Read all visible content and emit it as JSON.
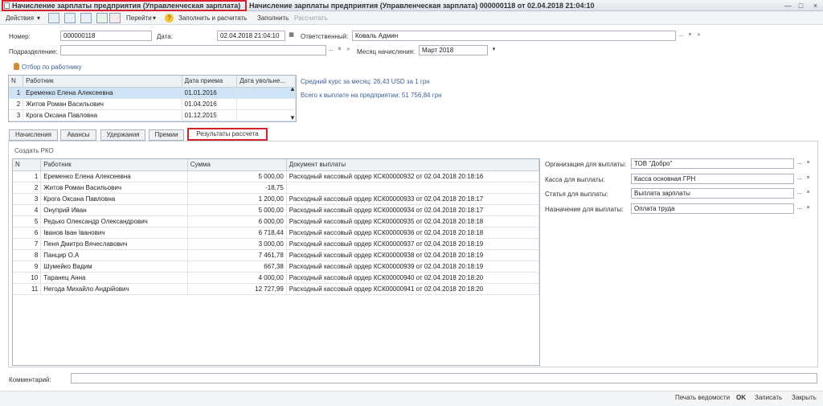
{
  "window": {
    "active_tab_title": "Начисление зарплаты предприятия (Управленческая зарплата)",
    "document_title": "Начисление зарплаты предприятия (Управленческая зарплата) 000000118 от 02.04.2018 21:04:10"
  },
  "toolbar": {
    "actions": "Действия",
    "go": "Перейти",
    "fill_and_calc": "Заполнить и расчитать",
    "fill": "Заполнить",
    "calc": "Рассчитать"
  },
  "header": {
    "number_label": "Номер:",
    "number_value": "000000118",
    "date_label": "Дата:",
    "date_value": "02.04.2018 21:04:10",
    "responsible_label": "Ответственный:",
    "responsible_value": "Коваль Админ",
    "department_label": "Подразделение:",
    "department_value": "",
    "month_label": "Месяц начисления:",
    "month_value": "Март 2018",
    "filter_label": "Отбор по работнику"
  },
  "employees_table": {
    "columns": [
      "N",
      "Работник",
      "Дата приема",
      "Дата увольне..."
    ],
    "rows": [
      [
        "1",
        "Еременко Елена Алексеевна",
        "01.01.2016",
        ""
      ],
      [
        "2",
        "Житов Роман Васильович",
        "01.04.2016",
        ""
      ],
      [
        "3",
        "Крога Оксана Павловна",
        "01.12.2015",
        ""
      ]
    ]
  },
  "info": {
    "rate": "Средний курс за месяц: 26,43 USD за 1 грн",
    "total": "Всего к выплате на предприятии: 51 756,84 грн"
  },
  "tabs": [
    "Начисления",
    "Авансы",
    "Удержания",
    "Премии",
    "Результаты рассчета"
  ],
  "results": {
    "create_rko": "Создать РКО",
    "columns": [
      "N",
      "Работник",
      "Сумма",
      "Документ выплаты"
    ],
    "rows": [
      [
        "1",
        "Еременко Елена Алексеевна",
        "5 000,00",
        "Расходный кассовый ордер КСК00000932 от 02.04.2018 20:18:16"
      ],
      [
        "2",
        "Житов Роман Васильович",
        "-18,75",
        ""
      ],
      [
        "3",
        "Крога Оксана Павловна",
        "1 200,00",
        "Расходный кассовый ордер КСК00000933 от 02.04.2018 20:18:17"
      ],
      [
        "4",
        "Онуприй Иван",
        "5 000,00",
        "Расходный кассовый ордер КСК00000934 от 02.04.2018 20:18:17"
      ],
      [
        "5",
        "Редько Олександр Олександрович",
        "6 000,00",
        "Расходный кассовый ордер КСК00000935 от 02.04.2018 20:18:18"
      ],
      [
        "6",
        "Іванов Іван Іванович",
        "6 718,44",
        "Расходный кассовый ордер КСК00000936 от 02.04.2018 20:18:18"
      ],
      [
        "7",
        "Пеня Дмитро Вячеславович",
        "3 000,00",
        "Расходный кассовый ордер КСК00000937 от 02.04.2018 20:18:19"
      ],
      [
        "8",
        "Панцир О.А",
        "7 461,78",
        "Расходный кассовый ордер КСК00000938 от 02.04.2018 20:18:19"
      ],
      [
        "9",
        "Шумейко Вадим",
        "667,38",
        "Расходный кассовый ордер КСК00000939 от 02.04.2018 20:18:19"
      ],
      [
        "10",
        "Таранец Анна",
        "4 000,00",
        "Расходный кассовый ордер КСК00000940 от 02.04.2018 20:18:20"
      ],
      [
        "11",
        "Негода Михайло Андрійович",
        "12 727,99",
        "Расходный кассовый ордер КСК00000941 от 02.04.2018 20:18:20"
      ]
    ]
  },
  "payment": {
    "org_label": "Организация для выплаты:",
    "org_value": "ТОВ \"Добро\"",
    "cash_label": "Касса для выплаты:",
    "cash_value": "Касса основная ГРН",
    "item_label": "Статья для выплаты:",
    "item_value": "Выплата зарплаты",
    "purpose_label": "Назначение для выплаты:",
    "purpose_value": "Оплата труда"
  },
  "footer": {
    "comment_label": "Комментарий:",
    "comment_value": "",
    "print": "Печать ведомости",
    "ok": "OK",
    "save": "Записать",
    "close": "Закрыть"
  },
  "icons": [
    "document-icon",
    "minimize-icon",
    "maximize-icon",
    "close-icon",
    "dropdown-icon",
    "calendar-icon",
    "select-icon",
    "clear-icon",
    "search-icon",
    "help-icon",
    "person-icon"
  ]
}
